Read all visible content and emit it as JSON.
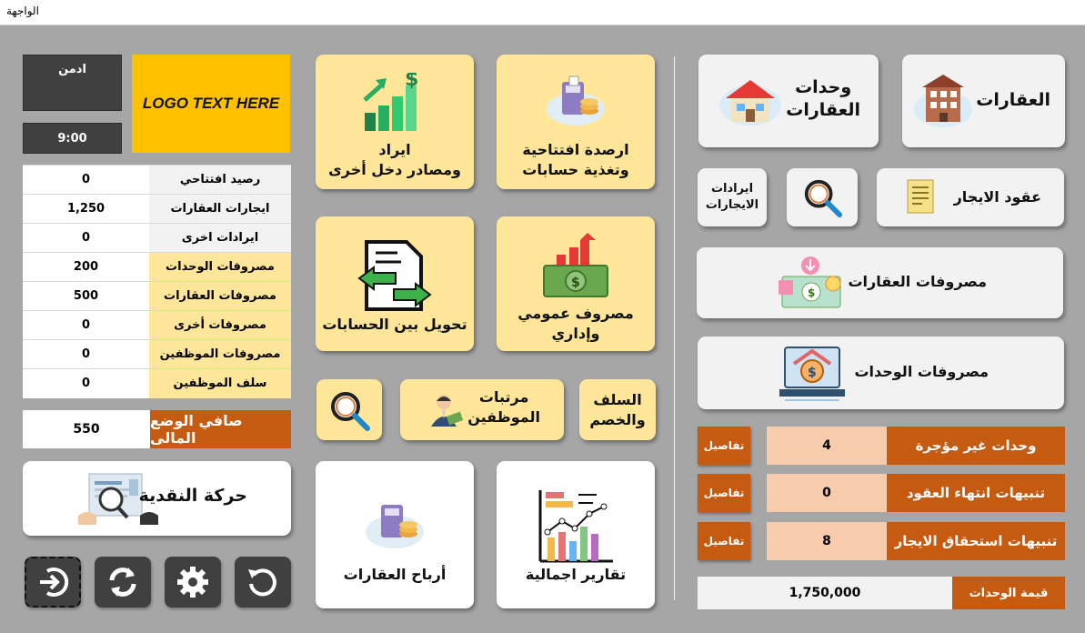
{
  "window": {
    "title": "الواجهة"
  },
  "user": {
    "name": "ادمن",
    "time": "9:00"
  },
  "logo": {
    "text": "LOGO TEXT HERE"
  },
  "summary": {
    "rows": [
      {
        "label": "رصيد افتتاحي",
        "value": "0"
      },
      {
        "label": "ايجارات العقارات",
        "value": "1,250"
      },
      {
        "label": "ايرادات اخرى",
        "value": "0"
      },
      {
        "label": "مصروفات الوحدات",
        "value": "200"
      },
      {
        "label": "مصروفات العقارات",
        "value": "500"
      },
      {
        "label": "مصروفات أخرى",
        "value": "0"
      },
      {
        "label": "مصروفات الموظفين",
        "value": "0"
      },
      {
        "label": "سلف الموظفين",
        "value": "0"
      }
    ],
    "net_label": "صافي الوضع المالى",
    "net_value": "550"
  },
  "cash_movement": {
    "label": "حركة النقدية"
  },
  "toolbar": {
    "exit": "exit-icon",
    "refresh": "refresh-icon",
    "settings": "gear-icon",
    "reset": "reset-icon"
  },
  "middle": {
    "income_line1": "ايراد",
    "income_line2": "ومصادر دخل أخرى",
    "opening_line1": "ارصدة افتتاحية",
    "opening_line2": "وتغذية حسابات",
    "transfer_label": "تحويل بين الحسابات",
    "general_expense_line1": "مصروف عمومي",
    "general_expense_line2": "وإداري",
    "salaries_line1": "مرتبات",
    "salaries_line2": "الموظفين",
    "advances_line1": "السلف",
    "advances_line2": "والخصم",
    "profits_label": "أرباح العقارات",
    "reports_label": "تقارير اجمالية"
  },
  "right": {
    "properties_label": "العقارات",
    "units_line1": "وحدات",
    "units_line2": "العقارات",
    "leases_label": "عقود الايجار",
    "rent_income_line1": "ايرادات",
    "rent_income_line2": "الايجارات",
    "property_expenses_label": "مصروفات العقارات",
    "unit_expenses_label": "مصروفات الوحدات"
  },
  "alerts": [
    {
      "label": "وحدات غير مؤجرة",
      "value": "4",
      "button": "تفاصيل"
    },
    {
      "label": "تنبيهات انتهاء العقود",
      "value": "0",
      "button": "تفاصيل"
    },
    {
      "label": "تنبيهات استحقاق الايجار",
      "value": "8",
      "button": "تفاصيل"
    }
  ],
  "units_value": {
    "label": "قيمة الوحدات",
    "value": "1,750,000"
  },
  "colors": {
    "background": "#a6a6a6",
    "accent": "#c55a11",
    "card_yellow": "#ffe699",
    "logo_yellow": "#ffc000",
    "dark": "#404040",
    "peach": "#f8cbad"
  }
}
